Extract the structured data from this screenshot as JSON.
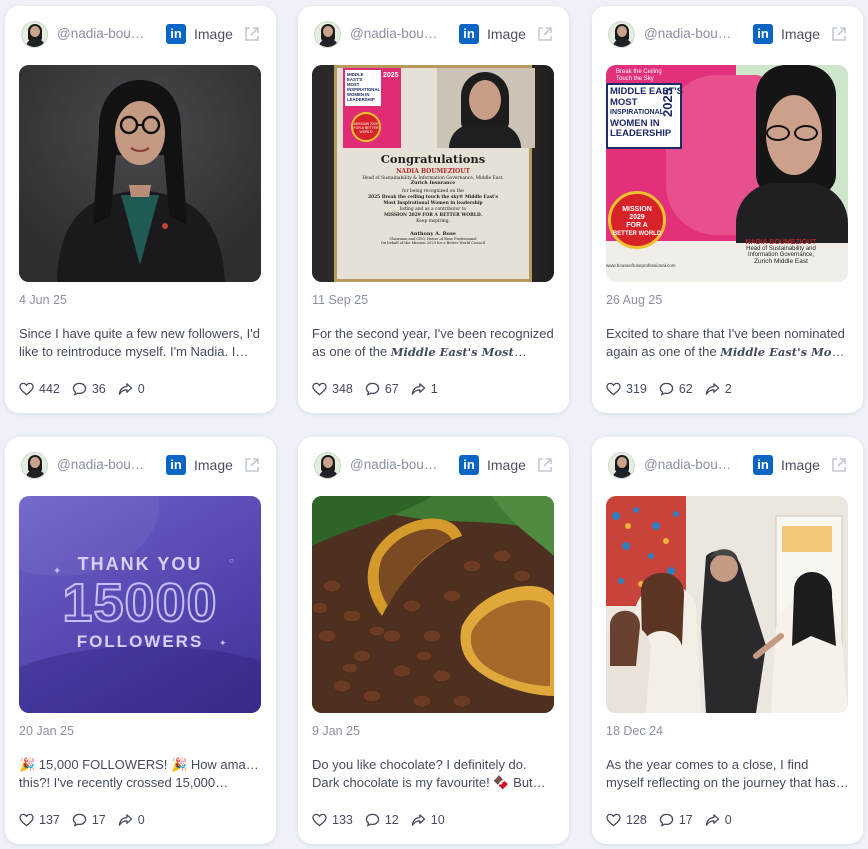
{
  "colors": {
    "linkedin": "#0a66c2",
    "page_bg": "#eef1f7",
    "card_bg": "#ffffff"
  },
  "icons": {
    "link": "linkedin-icon",
    "open": "external-link-icon",
    "like": "heart-icon",
    "comment": "comment-icon",
    "share": "share-icon"
  },
  "posts": [
    {
      "handle": "@nadia-bou…",
      "type": "Image",
      "date": "4 Jun 25",
      "line1": "Since I have quite a few new followers, I'd",
      "line2": "like to reintroduce myself. I'm Nadia. I…",
      "likes": "442",
      "comments": "36",
      "shares": "0"
    },
    {
      "handle": "@nadia-bou…",
      "type": "Image",
      "date": "11 Sep 25",
      "line1": "For the second year, I've been recognized",
      "line2_pre": "as one of the ",
      "line2_em": "Middle East's Most",
      "line2_post": "…",
      "likes": "348",
      "comments": "67",
      "shares": "1",
      "image": {
        "badge_lines": [
          "MIDDLE EAST'S",
          "MOST",
          "INSPIRATIONAL",
          "WOMEN IN",
          "LEADERSHIP",
          "2025"
        ],
        "seal": "MISSION 2029 FOR A BETTER WORLD",
        "heading": "Congratulations",
        "name": "NADIA BOUMEZIOUT",
        "role": "Head of Sustainability & Information Governance, Middle East,",
        "company": "Zurich Insurance",
        "body": [
          "for being recognized on the",
          "2025 Break the ceiling touch the sky® Middle East's",
          "Most Inspirational Women in leadership",
          "listing and as a contributor to",
          "MISSION 2029 FOR A BETTER WORLD.",
          "Keep inspiring,"
        ],
        "signer": "Anthony A. Rose",
        "signer_title": "Chairman and CEO, House of Rose Professional",
        "footer": "On behalf of the Mission 2029 for a Better World Council"
      }
    },
    {
      "handle": "@nadia-bou…",
      "type": "Image",
      "date": "26 Aug 25",
      "line1": "Excited to share that I've been nominated",
      "line2_pre": "again as one of the ",
      "line2_em": "Middle East's Most",
      "line2_post": "…",
      "likes": "319",
      "comments": "62",
      "shares": "2",
      "image": {
        "tagline": "Break the Ceiling Touch the Sky",
        "badge_lines": [
          "MIDDLE EAST'S",
          "MOST",
          "INSPIRATIONAL",
          "WOMEN IN",
          "LEADERSHIP"
        ],
        "year": "2025",
        "seal_lines": [
          "MISSION",
          "2029",
          "FOR A",
          "BETTER WORLD"
        ],
        "url": "www.houseofroseprofessional.com",
        "name": "NADIA BOUMEZIOUT",
        "role1": "Head of Sustainability and",
        "role2": "Information Governance,",
        "role3": "Zurich Middle East"
      }
    },
    {
      "handle": "@nadia-bou…",
      "type": "Image",
      "date": "20 Jan 25",
      "line1": "🎉 15,000 FOLLOWERS! 🎉 How amazing is",
      "line2": "this?! I've recently crossed 15,000…",
      "likes": "137",
      "comments": "17",
      "shares": "0",
      "image": {
        "top": "THANK YOU",
        "number": "15000",
        "bottom": "FOLLOWERS"
      }
    },
    {
      "handle": "@nadia-bou…",
      "type": "Image",
      "date": "9 Jan 25",
      "line1": "Do you like chocolate? I definitely do.",
      "line2": "Dark chocolate is my favourite! 🍫 But…",
      "likes": "133",
      "comments": "12",
      "shares": "10"
    },
    {
      "handle": "@nadia-bou…",
      "type": "Image",
      "date": "18 Dec 24",
      "line1": "As the year comes to a close, I find",
      "line2": "myself reflecting on the journey that has…",
      "likes": "128",
      "comments": "17",
      "shares": "0"
    }
  ]
}
